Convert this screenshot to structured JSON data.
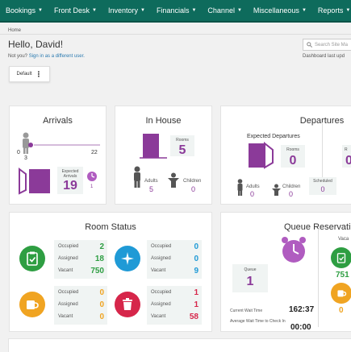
{
  "nav": [
    {
      "label": "Bookings"
    },
    {
      "label": "Front Desk"
    },
    {
      "label": "Inventory"
    },
    {
      "label": "Financials"
    },
    {
      "label": "Channel"
    },
    {
      "label": "Miscellaneous"
    },
    {
      "label": "Reports"
    }
  ],
  "breadcrumb": "Home",
  "greeting": "Hello, David!",
  "not_you_prefix": "Not you?",
  "not_you_link": "Sign in as a different user.",
  "search_placeholder": "Search Site Ma",
  "dashboard_updated": "Dashboard last upd",
  "default_button": "Default",
  "arrivals": {
    "title": "Arrivals",
    "slider_min": "0",
    "slider_max": "22",
    "slider_current": "3",
    "expected_label": "Expected Arrivals",
    "expected_value": "19",
    "late_value": "1"
  },
  "inhouse": {
    "title": "In House",
    "rooms_label": "Rooms",
    "rooms_value": "5",
    "adults_label": "Adults",
    "adults_value": "5",
    "children_label": "Children",
    "children_value": "0"
  },
  "departures": {
    "title": "Departures",
    "expected_label": "Expected Departures",
    "rooms_label": "Rooms",
    "rooms_value": "0",
    "adults_label": "Adults",
    "adults_value": "0",
    "children_label": "Children",
    "children_value": "0",
    "scheduled_label": "Scheduled",
    "scheduled_value": "0",
    "r_label": "R",
    "r_value": "0"
  },
  "room_status": {
    "title": "Room Status",
    "groups": [
      {
        "name": "clean",
        "color": "#2e9e42",
        "rows": [
          {
            "label": "Occupied",
            "value": "2"
          },
          {
            "label": "Assigned",
            "value": "18"
          },
          {
            "label": "Vacant",
            "value": "750"
          }
        ],
        "value_color": "#2e9e42"
      },
      {
        "name": "inspected",
        "color": "#1f9ad6",
        "rows": [
          {
            "label": "Occupied",
            "value": "0"
          },
          {
            "label": "Assigned",
            "value": "0"
          },
          {
            "label": "Vacant",
            "value": "9"
          }
        ],
        "value_color": "#1f9ad6"
      },
      {
        "name": "pickup",
        "color": "#f0a422",
        "rows": [
          {
            "label": "Occupied",
            "value": "0"
          },
          {
            "label": "Assigned",
            "value": "0"
          },
          {
            "label": "Vacant",
            "value": "0"
          }
        ],
        "value_color": "#f0a422"
      },
      {
        "name": "dirty",
        "color": "#d6264a",
        "rows": [
          {
            "label": "Occupied",
            "value": "1"
          },
          {
            "label": "Assigned",
            "value": "1"
          },
          {
            "label": "Vacant",
            "value": "58"
          }
        ],
        "value_color": "#d6264a"
      }
    ]
  },
  "queue": {
    "title": "Queue Reservatio",
    "queue_label": "Queue",
    "queue_value": "1",
    "current_wait_label": "Current Wait Time",
    "current_wait_value": "162:37",
    "avg_wait_label": "Average Wait Time to Check In",
    "avg_wait_value": "00:00",
    "vacant_label": "Vaca",
    "vacant_value": "751",
    "vacant_value2": "0"
  },
  "colors": {
    "nav_bg": "#0e6b5c",
    "accent_purple": "#8b3a99",
    "clean_green": "#2e9e42",
    "inspected_blue": "#1f9ad6",
    "pickup_orange": "#f0a422",
    "dirty_red": "#d6264a"
  }
}
